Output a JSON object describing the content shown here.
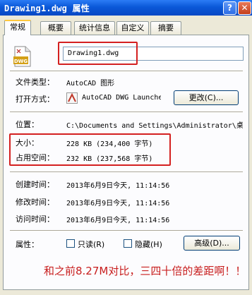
{
  "window": {
    "title": "Drawing1.dwg 属性"
  },
  "tabs": [
    {
      "label": "常规"
    },
    {
      "label": "概要"
    },
    {
      "label": "统计信息"
    },
    {
      "label": "自定义"
    },
    {
      "label": "摘要"
    }
  ],
  "general": {
    "file_name": "Drawing1.dwg",
    "file_type_label": "文件类型：",
    "file_type_value": "AutoCAD 图形",
    "opens_with_label": "打开方式：",
    "opens_with_value": "AutoCAD DWG Launche",
    "change_button": "更改(C)...",
    "location_label": "位置：",
    "location_value": "C:\\Documents and Settings\\Administrator\\桌",
    "size_label": "大小：",
    "size_value": "228 KB (234,400 字节)",
    "size_on_disk_label": "占用空间：",
    "size_on_disk_value": "232 KB (237,568 字节)",
    "created_label": "创建时间：",
    "created_value": "2013年6月9日今天, 11:14:56",
    "modified_label": "修改时间：",
    "modified_value": "2013年6月9日今天, 11:14:56",
    "accessed_label": "访问时间：",
    "accessed_value": "2013年6月9日今天, 11:14:56",
    "attributes_label": "属性：",
    "readonly_label": "只读(R)",
    "hidden_label": "隐藏(H)",
    "advanced_button": "高级(D)..."
  },
  "annotation": {
    "text": "和之前8.27M对比，三四十倍的差距啊！！"
  },
  "colors": {
    "annotation_red": "#d42020",
    "titlebar_blue": "#0a58d8"
  },
  "icons": {
    "file": "dwg-file-icon",
    "app": "autocad-app-icon"
  }
}
